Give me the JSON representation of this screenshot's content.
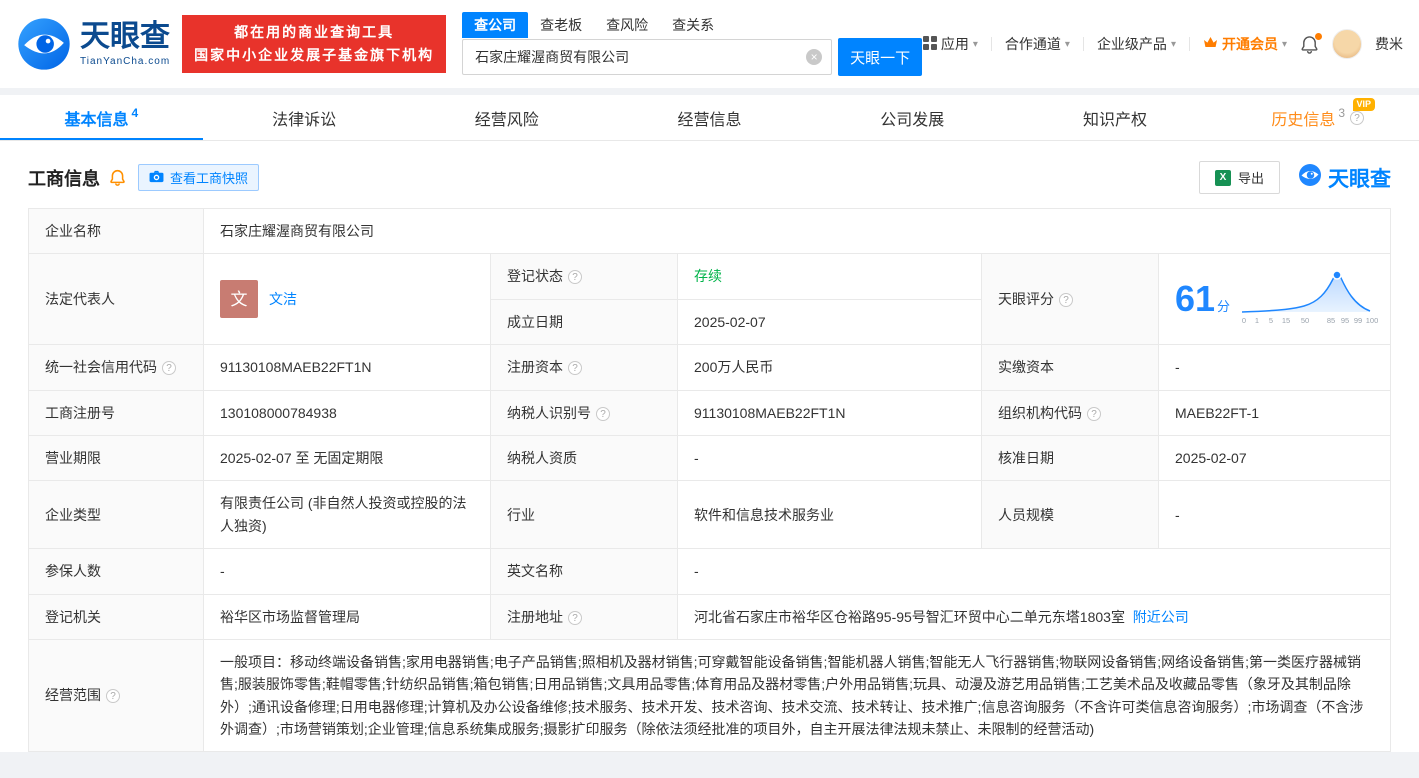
{
  "header": {
    "logo": {
      "brand": "天眼查",
      "domain": "TianYanCha.com"
    },
    "slogan": {
      "line1": "都在用的商业查询工具",
      "line2": "国家中小企业发展子基金旗下机构"
    },
    "search": {
      "tabs": [
        {
          "label": "查公司",
          "active": true
        },
        {
          "label": "查老板",
          "active": false
        },
        {
          "label": "查风险",
          "active": false
        },
        {
          "label": "查关系",
          "active": false
        }
      ],
      "value": "石家庄耀渥商贸有限公司",
      "button": "天眼一下"
    },
    "nav": {
      "apps": "应用",
      "partners": "合作通道",
      "enterprise": "企业级产品",
      "vip": "开通会员",
      "username": "费米"
    }
  },
  "tabs": [
    {
      "label": "基本信息",
      "count": "4",
      "active": true
    },
    {
      "label": "法律诉讼"
    },
    {
      "label": "经营风险"
    },
    {
      "label": "经营信息"
    },
    {
      "label": "公司发展"
    },
    {
      "label": "知识产权"
    },
    {
      "label": "历史信息",
      "count": "3",
      "badge": "VIP"
    }
  ],
  "section": {
    "title": "工商信息",
    "snapshot_button": "查看工商快照",
    "export_button": "导出",
    "watermark": "天眼查"
  },
  "fields": {
    "company_name": {
      "label": "企业名称",
      "value": "石家庄耀渥商贸有限公司"
    },
    "legal_rep": {
      "label": "法定代表人",
      "value": "文洁",
      "avatar": "文"
    },
    "reg_status": {
      "label": "登记状态",
      "value": "存续"
    },
    "establish_date": {
      "label": "成立日期",
      "value": "2025-02-07"
    },
    "score": {
      "label": "天眼评分",
      "value": "61",
      "unit": "分"
    },
    "credit_code": {
      "label": "统一社会信用代码",
      "value": "91130108MAEB22FT1N"
    },
    "reg_capital": {
      "label": "注册资本",
      "value": "200万人民币"
    },
    "paid_capital": {
      "label": "实缴资本",
      "value": "-"
    },
    "reg_number": {
      "label": "工商注册号",
      "value": "130108000784938"
    },
    "taxpayer_id": {
      "label": "纳税人识别号",
      "value": "91130108MAEB22FT1N"
    },
    "org_code": {
      "label": "组织机构代码",
      "value": "MAEB22FT-1"
    },
    "business_term": {
      "label": "营业期限",
      "value": "2025-02-07 至 无固定期限"
    },
    "taxpayer_quality": {
      "label": "纳税人资质",
      "value": "-"
    },
    "approval_date": {
      "label": "核准日期",
      "value": "2025-02-07"
    },
    "company_type": {
      "label": "企业类型",
      "value": "有限责任公司 (非自然人投资或控股的法人独资)"
    },
    "industry": {
      "label": "行业",
      "value": "软件和信息技术服务业"
    },
    "staff_size": {
      "label": "人员规模",
      "value": "-"
    },
    "insured_count": {
      "label": "参保人数",
      "value": "-"
    },
    "english_name": {
      "label": "英文名称",
      "value": "-"
    },
    "reg_authority": {
      "label": "登记机关",
      "value": "裕华区市场监督管理局"
    },
    "reg_address": {
      "label": "注册地址",
      "value": "河北省石家庄市裕华区仓裕路95-95号智汇环贸中心二单元东塔1803室",
      "link": "附近公司"
    },
    "business_scope": {
      "label": "经营范围",
      "value": "一般项目：移动终端设备销售;家用电器销售;电子产品销售;照相机及器材销售;可穿戴智能设备销售;智能机器人销售;智能无人飞行器销售;物联网设备销售;网络设备销售;第一类医疗器械销售;服装服饰零售;鞋帽零售;针纺织品销售;箱包销售;日用品销售;文具用品零售;体育用品及器材零售;户外用品销售;玩具、动漫及游艺用品销售;工艺美术品及收藏品零售（象牙及其制品除外）;通讯设备修理;日用电器修理;计算机及办公设备维修;技术服务、技术开发、技术咨询、技术交流、技术转让、技术推广;信息咨询服务（不含许可类信息咨询服务）;市场调查（不含涉外调查）;市场营销策划;企业管理;信息系统集成服务;摄影扩印服务（除依法须经批准的项目外，自主开展法律法规未禁止、未限制的经营活动)"
    }
  },
  "chart_data": {
    "type": "area",
    "title": "天眼评分分布曲线",
    "score": 61,
    "x_tick_labels": [
      "0",
      "1",
      "5",
      "15",
      "50",
      "85",
      "95",
      "99",
      "100"
    ],
    "accent_color": "#1f87ff"
  }
}
